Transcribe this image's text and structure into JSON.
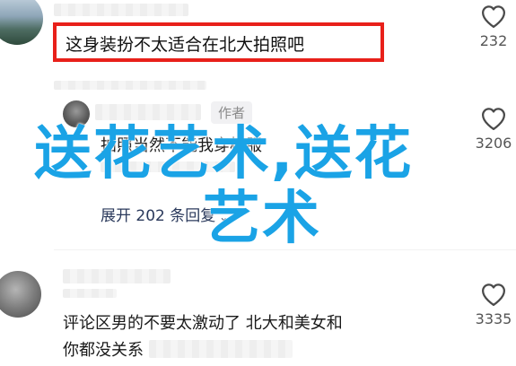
{
  "comments": [
    {
      "text": "这身装扮不太适合在北大拍照吧",
      "likes": "232",
      "highlighted": true
    },
    {
      "author_tag": "作者",
      "text": "拍照当然不能我穿校服",
      "expand_label": "展开 202 条回复",
      "likes": "3206"
    },
    {
      "text_line1": "评论区男的不要太激动了 北大和美女和",
      "text_line2": "你都没关系",
      "likes": "3335"
    }
  ],
  "watermark": {
    "line1": "送花艺术,送花",
    "line2": "艺术"
  },
  "colors": {
    "highlight_border": "#e8201a",
    "watermark": "#1aa3e6",
    "link": "#2b3a5c"
  },
  "icons": {
    "like": "heart-outline-icon",
    "expand": "chevron-down-icon"
  }
}
